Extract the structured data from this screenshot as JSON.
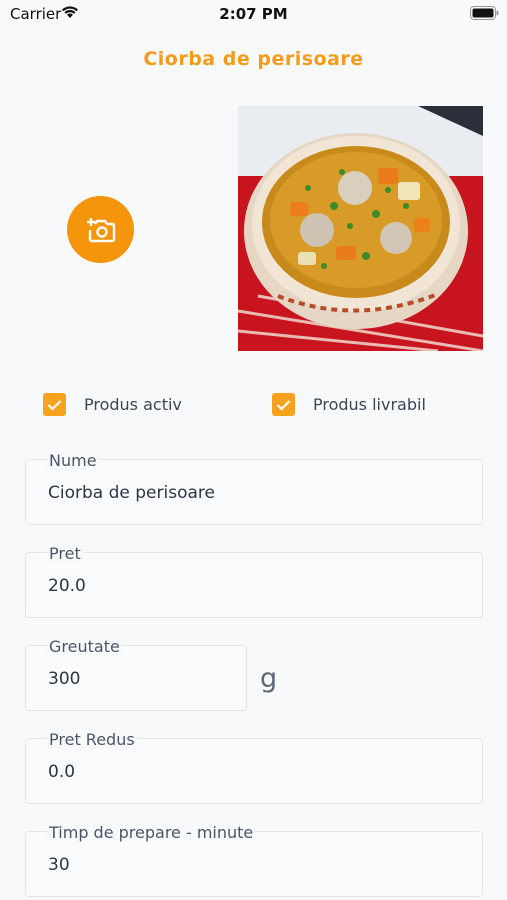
{
  "status_bar": {
    "carrier": "Carrier",
    "time": "2:07 PM"
  },
  "header": {
    "title": "Ciorba de perisoare"
  },
  "photo": {
    "add_icon": "add-photo-camera-icon",
    "accent": "#f4950b"
  },
  "options": {
    "active": {
      "label": "Produs activ",
      "checked": true
    },
    "deliverable": {
      "label": "Produs livrabil",
      "checked": true
    }
  },
  "fields": {
    "name": {
      "label": "Nume",
      "value": "Ciorba de perisoare"
    },
    "price": {
      "label": "Pret",
      "value": "20.0"
    },
    "weight": {
      "label": "Greutate",
      "value": "300",
      "unit": "g"
    },
    "discount_price": {
      "label": "Pret Redus",
      "value": "0.0"
    },
    "prep_time": {
      "label": "Timp de prepare - minute",
      "value": "30"
    }
  }
}
